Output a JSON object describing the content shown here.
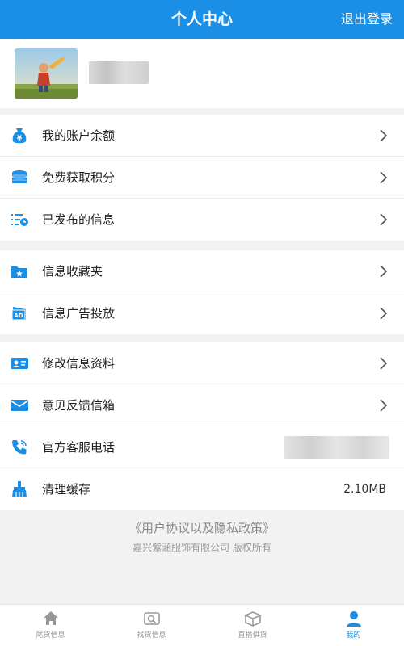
{
  "header": {
    "title": "个人中心",
    "logout_label": "退出登录"
  },
  "colors": {
    "accent": "#1b8fe6",
    "background": "#f2f2f2"
  },
  "profile": {
    "avatar": "avatar-image"
  },
  "groups": [
    {
      "items": [
        {
          "label": "我的账户余额",
          "icon": "money-bag-icon"
        },
        {
          "label": "免费获取积分",
          "icon": "coins-icon"
        },
        {
          "label": "已发布的信息",
          "icon": "list-clock-icon"
        }
      ]
    },
    {
      "items": [
        {
          "label": "信息收藏夹",
          "icon": "folder-star-icon"
        },
        {
          "label": "信息广告投放",
          "icon": "ad-card-icon"
        }
      ]
    },
    {
      "items": [
        {
          "label": "修改信息资料",
          "icon": "id-card-icon"
        },
        {
          "label": "意见反馈信箱",
          "icon": "mail-icon"
        },
        {
          "label": "官方客服电话",
          "icon": "phone-icon"
        },
        {
          "label": "清理缓存",
          "icon": "broom-icon",
          "value": "2.10MB"
        }
      ]
    }
  ],
  "legal": {
    "policy": "《用户协议以及隐私政策》",
    "copyright": "嘉兴紫涵服饰有限公司 版权所有"
  },
  "tabs": [
    {
      "label": "尾货信息",
      "icon": "home-icon"
    },
    {
      "label": "找货信息",
      "icon": "search-goods-icon"
    },
    {
      "label": "直播供货",
      "icon": "live-box-icon"
    },
    {
      "label": "我的",
      "icon": "user-icon",
      "active": true
    }
  ]
}
